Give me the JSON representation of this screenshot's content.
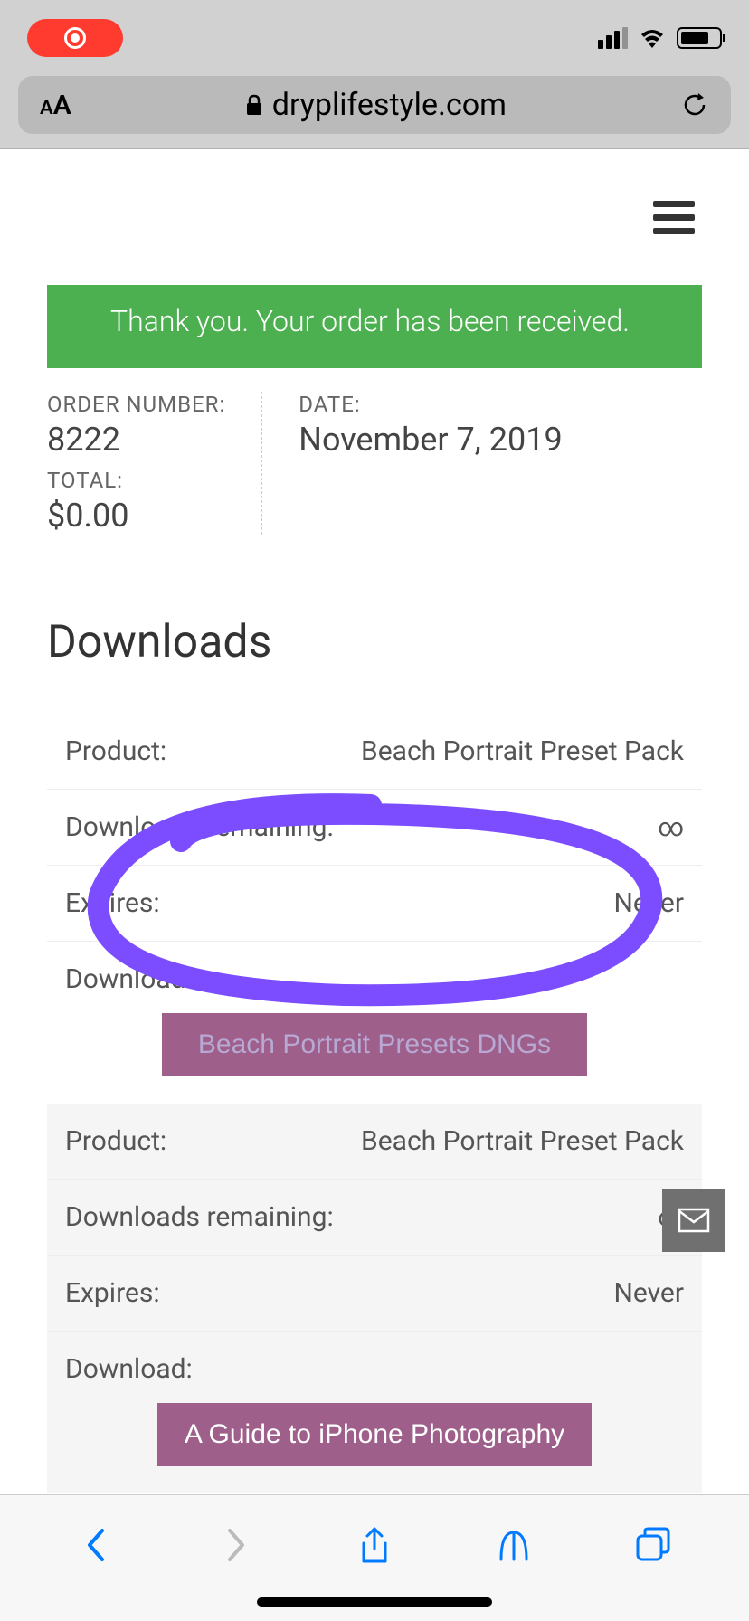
{
  "address_bar": {
    "url": "dryplifestyle.com"
  },
  "success_message": "Thank you. Your order has been received.",
  "order": {
    "order_number_label": "ORDER NUMBER:",
    "order_number": "8222",
    "date_label": "DATE:",
    "date": "November 7, 2019",
    "total_label": "TOTAL:",
    "total": "$0.00"
  },
  "downloads": {
    "heading": "Downloads",
    "rows": [
      {
        "product_label": "Product:",
        "product_value": "Beach Portrait Preset Pack",
        "remaining_label": "Downloads remaining:",
        "remaining_value": "∞",
        "expires_label": "Expires:",
        "expires_value": "Never",
        "download_label": "Download:",
        "button_text": "Beach Portrait Presets DNGs"
      },
      {
        "product_label": "Product:",
        "product_value": "Beach Portrait Preset Pack",
        "remaining_label": "Downloads remaining:",
        "remaining_value": "∞",
        "expires_label": "Expires:",
        "expires_value": "Never",
        "download_label": "Download:",
        "button_text": "A Guide to iPhone Photography"
      }
    ]
  }
}
